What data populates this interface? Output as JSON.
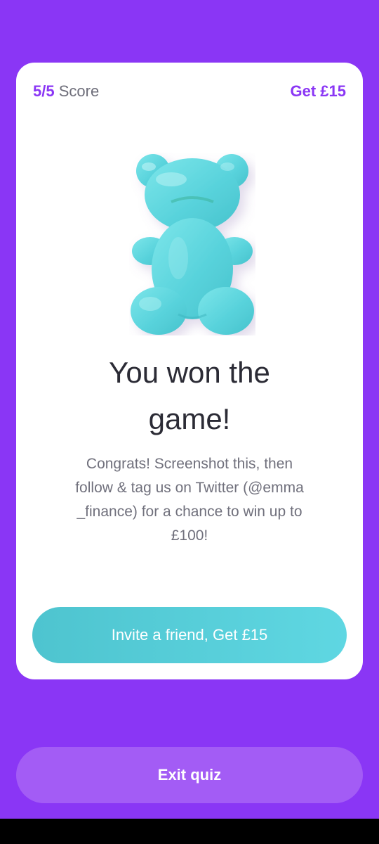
{
  "header": {
    "score_value": "5/5",
    "score_label": " Score",
    "reward_link": "Get £15"
  },
  "illustration": {
    "icon": "gummy-bear-icon",
    "color": "#5fd8de"
  },
  "result": {
    "title_line1": "You won the",
    "title_line2": "game!",
    "message_line1": "Congrats! Screenshot this, then",
    "message_line2": "follow & tag us on Twitter (@emma",
    "message_line3": "_finance) for a chance to win up to",
    "message_line4": "£100!"
  },
  "actions": {
    "invite_label": "Invite a friend, Get £15",
    "exit_label": "Exit quiz"
  },
  "colors": {
    "background": "#8a36f5",
    "accent_teal": "#55ccd8",
    "exit_button": "#a35cf5"
  }
}
